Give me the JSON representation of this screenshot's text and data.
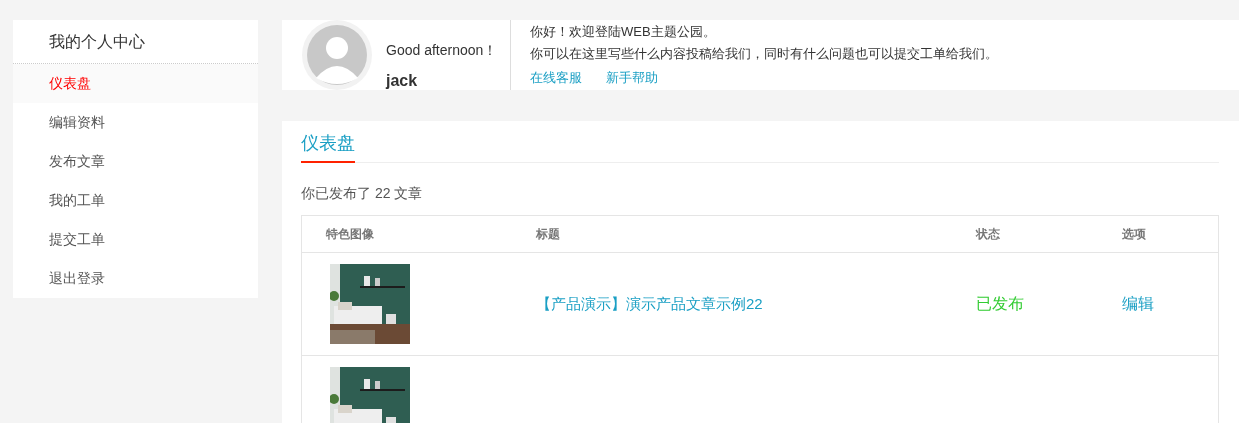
{
  "sidebar": {
    "title": "我的个人中心",
    "items": [
      {
        "label": "仪表盘",
        "selected": true
      },
      {
        "label": "编辑资料",
        "selected": false
      },
      {
        "label": "发布文章",
        "selected": false
      },
      {
        "label": "我的工单",
        "selected": false
      },
      {
        "label": "提交工单",
        "selected": false
      },
      {
        "label": "退出登录",
        "selected": false
      }
    ]
  },
  "profile": {
    "greeting": "Good afternoon！",
    "username": "jack",
    "welcome": "你好！欢迎登陆WEB主题公园。",
    "message": "你可以在这里写些什么内容投稿给我们，同时有什么问题也可以提交工单给我们。",
    "links": [
      "在线客服",
      "新手帮助"
    ]
  },
  "dashboard": {
    "tab": "仪表盘",
    "summary": "你已发布了 22 文章",
    "table": {
      "columns": [
        "特色图像",
        "标题",
        "状态",
        "选项"
      ],
      "rows": [
        {
          "image": {
            "kind": "picture"
          },
          "title": "【产品演示】演示产品文章示例22",
          "status": {
            "label": "已发布",
            "kind": "published"
          },
          "option": "编辑"
        },
        {
          "image": {
            "kind": "picture"
          }
        }
      ]
    }
  }
}
